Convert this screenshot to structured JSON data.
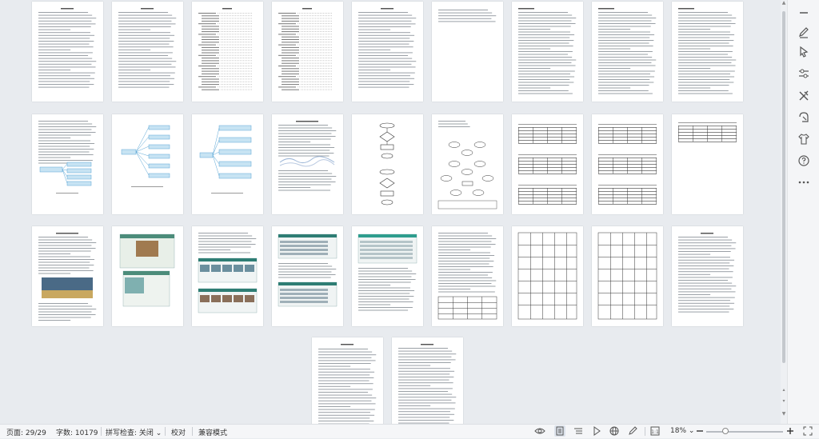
{
  "statusbar": {
    "page_label": "页面: 29/29",
    "word_count": "字数: 10179",
    "spellcheck": "拼写检查: 关闭",
    "proofread": "校对",
    "compat_mode": "兼容模式",
    "zoom": "18%"
  },
  "canvas": {
    "page_count": 29
  },
  "rightbar": {
    "tools": [
      "minus-icon",
      "pen-icon",
      "cursor-icon",
      "settings-slider-icon",
      "tools-icon",
      "crop-icon",
      "shirt-icon",
      "help-icon",
      "more-icon"
    ]
  }
}
